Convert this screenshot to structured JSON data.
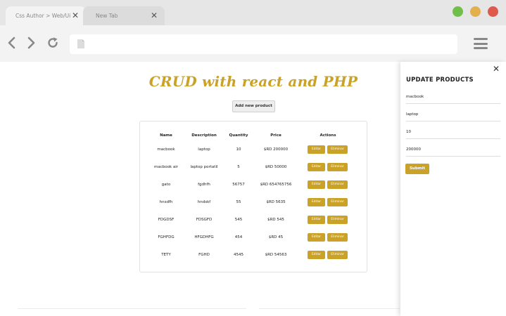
{
  "browser": {
    "tabs": [
      {
        "title": "Css Author > Web/Ui",
        "close": "✕"
      },
      {
        "title": "New Tab",
        "close": "✕"
      }
    ],
    "window_dots": [
      "#6fbf4a",
      "#e3b050",
      "#de5a4c"
    ]
  },
  "page": {
    "title": "CRUD with react and PHP",
    "add_button": "Add new product"
  },
  "table": {
    "headers": [
      "Name",
      "Description",
      "Quantity",
      "Price",
      "Actions"
    ],
    "edit_label": "Editar",
    "delete_label": "Eliminar",
    "rows": [
      {
        "name": "macbook",
        "description": "laptop",
        "quantity": "10",
        "price": "$RD 200000"
      },
      {
        "name": "macbook air",
        "description": "laptop portatil",
        "quantity": "5",
        "price": "$RD 50000"
      },
      {
        "name": "gato",
        "description": "fgdhfh",
        "quantity": "56757",
        "price": "$RD 654765756"
      },
      {
        "name": "hnsdfh",
        "description": "hndskf",
        "quantity": "55",
        "price": "$RD 5635"
      },
      {
        "name": "FDGDSF",
        "description": "FDSGFD",
        "quantity": "545",
        "price": "$RD 545"
      },
      {
        "name": "FGHFDG",
        "description": "HFGDHFG",
        "quantity": "454",
        "price": "$RD 45"
      },
      {
        "name": "TETY",
        "description": "FGHD",
        "quantity": "4545",
        "price": "$RD 54563"
      }
    ]
  },
  "panel": {
    "close": "✕",
    "title": "UPDATE PRODUCTS",
    "fields": [
      "macbook",
      "laptop",
      "10",
      "200000"
    ],
    "submit": "Submit"
  },
  "colors": {
    "accent": "#c9a227"
  }
}
